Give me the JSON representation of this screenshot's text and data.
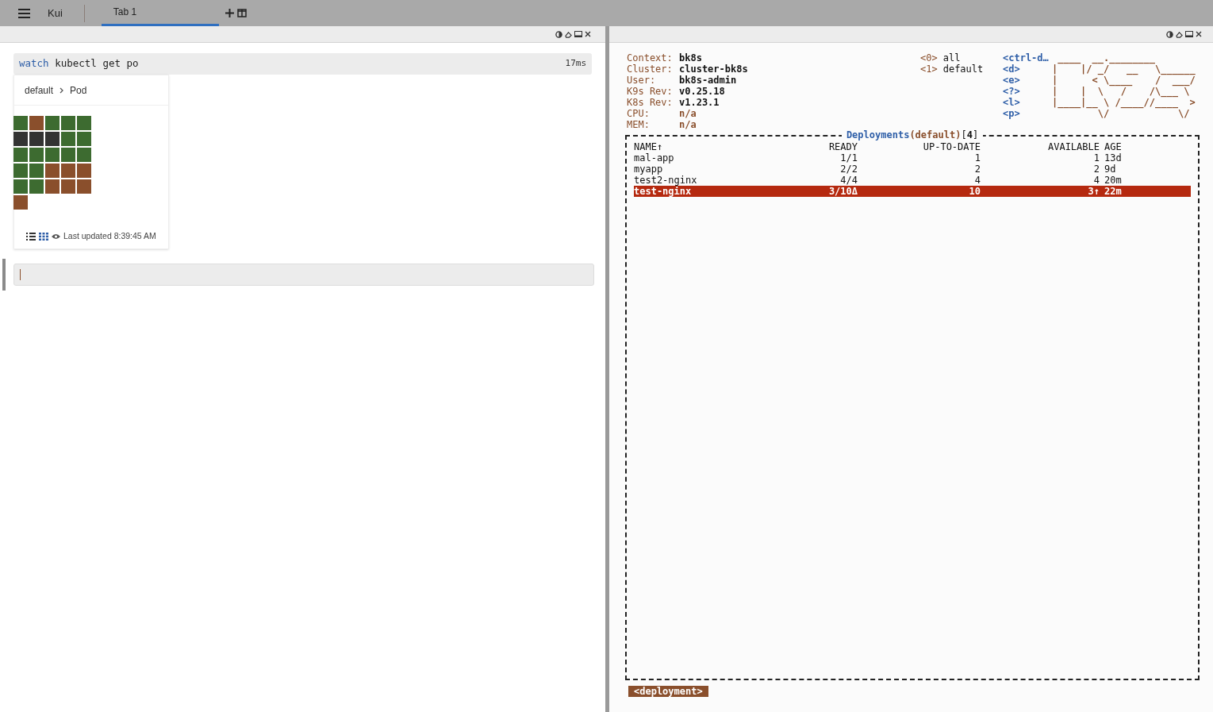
{
  "topbar": {
    "app": "Kui",
    "tabs": [
      {
        "label": "Tab 1",
        "selected": true
      }
    ]
  },
  "left_pane": {
    "command": {
      "verb": "watch",
      "rest": "kubectl get po",
      "duration": "17ms"
    },
    "breadcrumb": [
      "default",
      "Pod"
    ],
    "pods": [
      {
        "color": "#3d6b30"
      },
      {
        "color": "#8a4f2c"
      },
      {
        "color": "#3d6b30"
      },
      {
        "color": "#3d6b30"
      },
      {
        "color": "#3d6b30"
      },
      {
        "color": "#333333"
      },
      {
        "color": "#333333"
      },
      {
        "color": "#333333"
      },
      {
        "color": "#3d6b30"
      },
      {
        "color": "#3d6b30"
      },
      {
        "color": "#3d6b30"
      },
      {
        "color": "#3d6b30"
      },
      {
        "color": "#3d6b30"
      },
      {
        "color": "#3d6b30"
      },
      {
        "color": "#3d6b30"
      },
      {
        "color": "#3d6b30"
      },
      {
        "color": "#3d6b30"
      },
      {
        "color": "#8a4f2c"
      },
      {
        "color": "#8a4f2c"
      },
      {
        "color": "#8a4f2c"
      },
      {
        "color": "#3d6b30"
      },
      {
        "color": "#3d6b30"
      },
      {
        "color": "#8a4f2c"
      },
      {
        "color": "#8a4f2c"
      },
      {
        "color": "#8a4f2c"
      },
      {
        "color": "#8a4f2c"
      }
    ],
    "views": [
      {
        "kind": "list",
        "selected": false
      },
      {
        "kind": "grid",
        "selected": true
      }
    ],
    "last_updated": "Last updated 8:39:45 AM"
  },
  "right_pane": {
    "info": [
      {
        "label": "Context:",
        "value": "bk8s",
        "kind": "value"
      },
      {
        "label": "Cluster:",
        "value": "cluster-bk8s",
        "kind": "value"
      },
      {
        "label": "User:",
        "value": "bk8s-admin",
        "kind": "value"
      },
      {
        "label": "K9s Rev:",
        "value": "v0.25.18",
        "kind": "value"
      },
      {
        "label": "K8s Rev:",
        "value": "v1.23.1",
        "kind": "value"
      },
      {
        "label": "CPU:",
        "value": "n/a",
        "kind": "metric"
      },
      {
        "label": "MEM:",
        "value": "n/a",
        "kind": "metric"
      }
    ],
    "namespaces": [
      {
        "key": "<0>",
        "name": "all"
      },
      {
        "key": "<1>",
        "name": "default"
      }
    ],
    "hotkeys": [
      "<ctrl-d…",
      "<d>",
      "<e>",
      "<?>",
      "<l>",
      "<p>"
    ],
    "logo": [
      " ____  __.________",
      "|    |/ _/   __   \\______",
      "|      < \\____    /  ___/",
      "|    |  \\   /    /\\___ \\",
      "|____|__ \\ /____//____  >",
      "        \\/            \\/"
    ],
    "table": {
      "title": "Deployments",
      "namespace": "(default)",
      "count": "[**4**]",
      "columns": [
        "NAME↑",
        "READY",
        "UP-TO-DATE",
        "AVAILABLE",
        "AGE"
      ],
      "rows": [
        {
          "cells": [
            "mal-app",
            "1/1",
            "1",
            "1",
            "13d"
          ],
          "selected": false
        },
        {
          "cells": [
            "myapp",
            "2/2",
            "2",
            "2",
            "9d"
          ],
          "selected": false
        },
        {
          "cells": [
            "test2-nginx",
            "4/4",
            "4",
            "4",
            "20m"
          ],
          "selected": false
        },
        {
          "cells": [
            "test-nginx",
            "3/10Δ",
            "10",
            "3↑",
            "22m"
          ],
          "selected": true
        }
      ]
    },
    "crumb": "<deployment>"
  }
}
